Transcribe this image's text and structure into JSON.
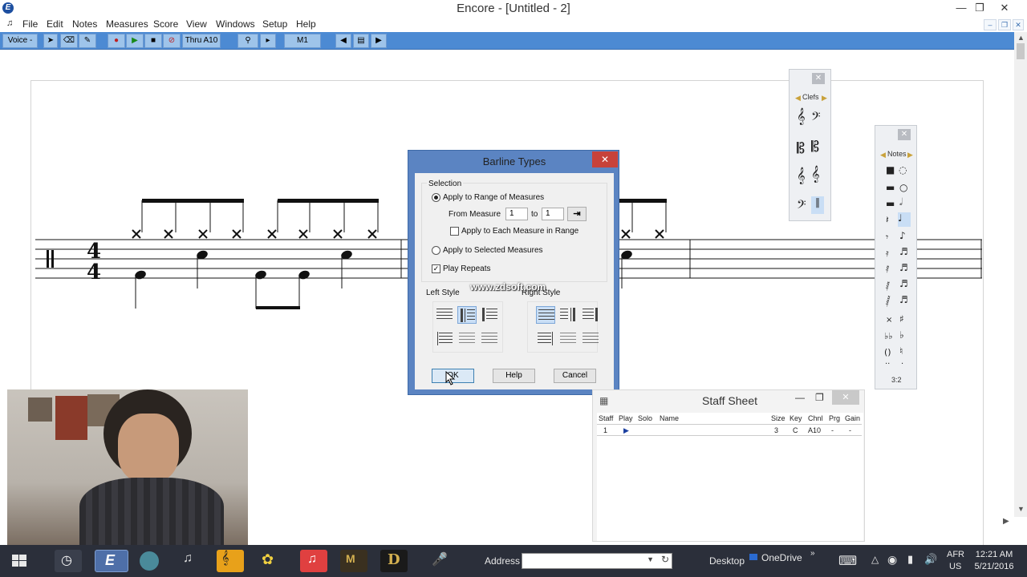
{
  "window": {
    "title": "Encore - [Untitled - 2]"
  },
  "menu": [
    "File",
    "Edit",
    "Notes",
    "Measures",
    "Score",
    "View",
    "Windows",
    "Setup",
    "Help"
  ],
  "toolbar": {
    "voice": "Voice -",
    "thru": "Thru A10",
    "measure": "M1"
  },
  "palettes": {
    "clefs_title": "Clefs",
    "notes_title": "Notes",
    "notes_tuplet": "3:2"
  },
  "dialog": {
    "title": "Barline Types",
    "selection_label": "Selection",
    "apply_range": "Apply to Range of Measures",
    "from_measure_label": "From Measure",
    "from_value": "1",
    "to_label": "to",
    "to_value": "1",
    "apply_each": "Apply to Each Measure in Range",
    "apply_selected": "Apply to Selected Measures",
    "play_repeats": "Play Repeats",
    "left_style": "Left Style",
    "right_style": "Right Style",
    "ok": "OK",
    "help": "Help",
    "cancel": "Cancel"
  },
  "watermark": "www.zdsoft.com",
  "staff_sheet": {
    "title": "Staff Sheet",
    "headers": [
      "Staff",
      "Play",
      "Solo",
      "Name",
      "Size",
      "Key",
      "Chnl",
      "Prg",
      "Gain"
    ],
    "row": {
      "staff": "1",
      "play": "▶",
      "solo": "",
      "name": "",
      "size": "3",
      "key": "C",
      "chnl": "A10",
      "prg": "-",
      "gain": "-"
    }
  },
  "score": {
    "time_top": "4",
    "time_bottom": "4"
  },
  "taskbar": {
    "address_label": "Address",
    "desktop": "Desktop",
    "onedrive": "OneDrive",
    "lang_top": "AFR",
    "lang_bottom": "US",
    "time": "12:21 AM",
    "date": "5/21/2016"
  },
  "colors": {
    "toolbar": "#4c8ad3",
    "dialog_frame": "#5b84c2",
    "close_red": "#c7423a",
    "taskbar": "#2b2f3a"
  }
}
